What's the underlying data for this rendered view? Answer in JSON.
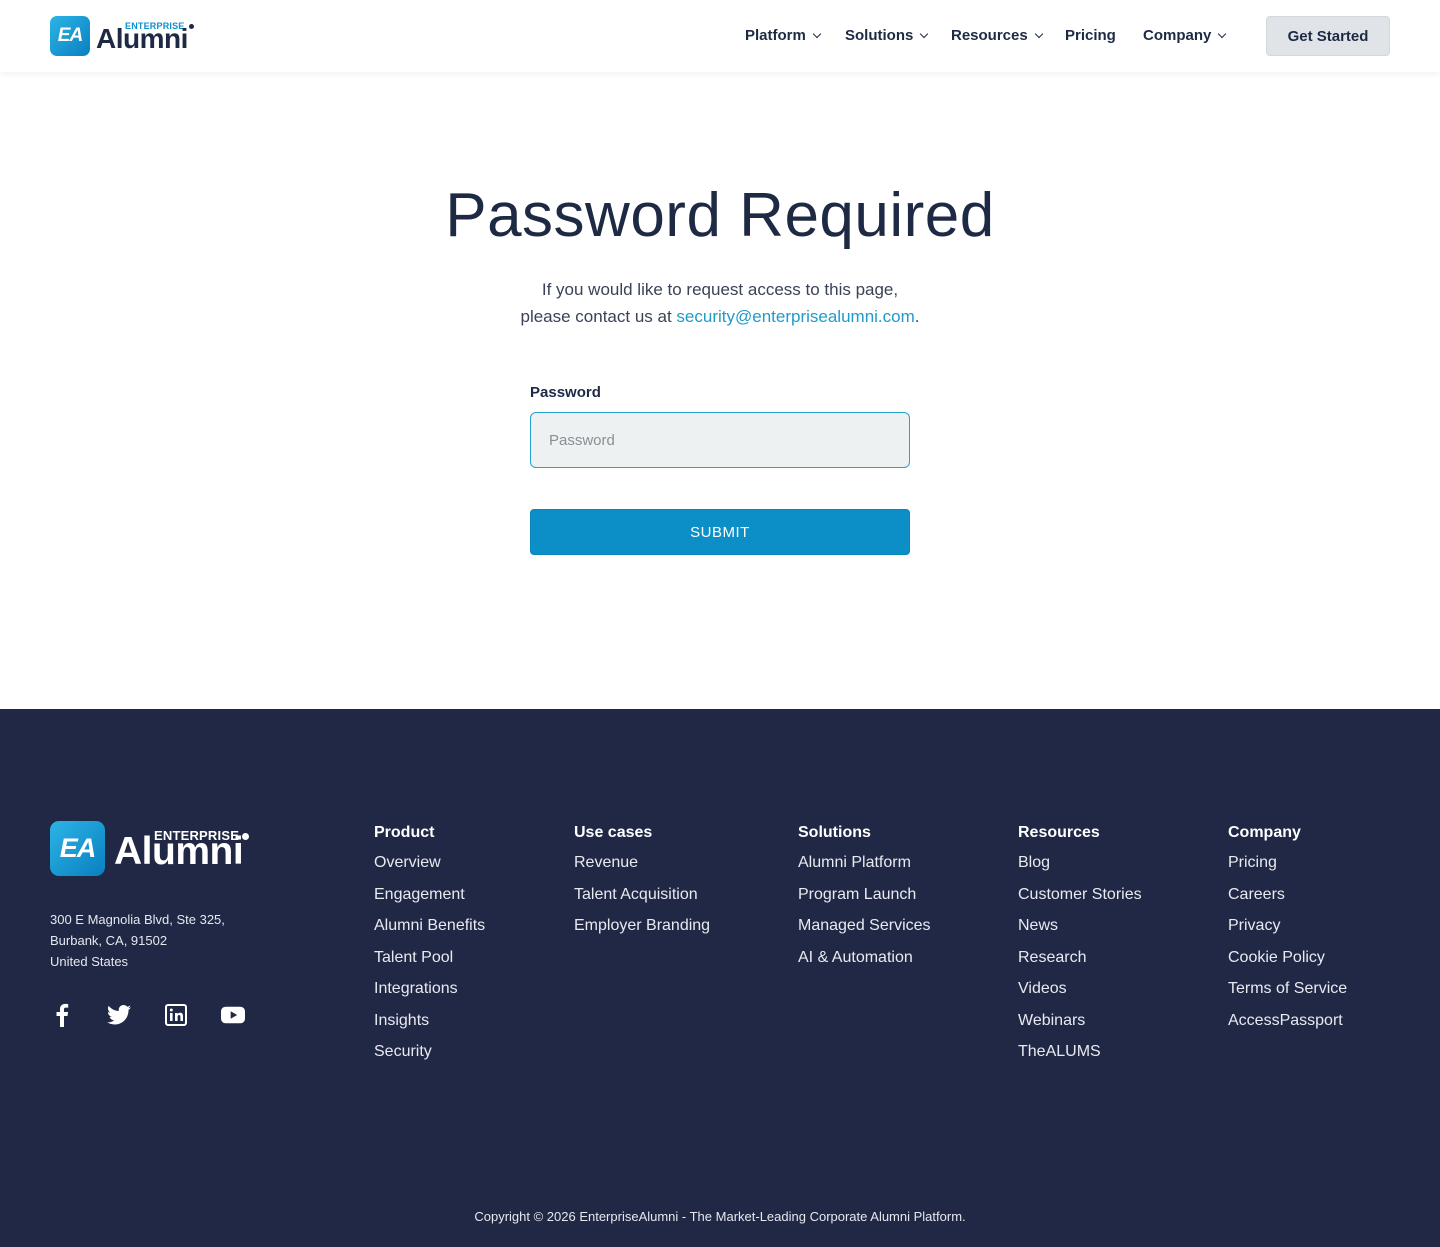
{
  "header": {
    "logo_small": "ENTERPRISE",
    "logo_big": "Alumni",
    "logo_mark": "EA",
    "nav": [
      {
        "label": "Platform",
        "dropdown": true
      },
      {
        "label": "Solutions",
        "dropdown": true
      },
      {
        "label": "Resources",
        "dropdown": true
      },
      {
        "label": "Pricing",
        "dropdown": false
      },
      {
        "label": "Company",
        "dropdown": true
      }
    ],
    "cta_label": "Get Started"
  },
  "main": {
    "title": "Password Required",
    "desc_line1": "If you would like to request access to this page,",
    "desc_line2_prefix": "please contact us at ",
    "email": "security@enterprisealumni.com",
    "desc_line2_suffix": ".",
    "password_label": "Password",
    "password_placeholder": "Password",
    "password_value": "",
    "submit_label": "SUBMIT"
  },
  "footer": {
    "logo_small": "ENTERPRISE",
    "logo_big": "Alumni",
    "logo_mark": "EA",
    "address": [
      "300 E Magnolia Blvd, Ste 325,",
      "Burbank, CA, 91502",
      "United States"
    ],
    "socials": [
      "facebook-icon",
      "twitter-icon",
      "linkedin-icon",
      "youtube-icon"
    ],
    "columns": [
      {
        "heading": "Product",
        "links": [
          "Overview",
          "Engagement",
          "Alumni Benefits",
          "Talent Pool",
          "Integrations",
          "Insights",
          "Security"
        ]
      },
      {
        "heading": "Use cases",
        "links": [
          "Revenue",
          "Talent Acquisition",
          "Employer Branding"
        ]
      },
      {
        "heading": "Solutions",
        "links": [
          "Alumni Platform",
          "Program Launch",
          "Managed Services",
          "AI & Automation"
        ]
      },
      {
        "heading": "Resources",
        "links": [
          "Blog",
          "Customer Stories",
          "News",
          "Research",
          "Videos",
          "Webinars",
          "TheALUMS"
        ]
      },
      {
        "heading": "Company",
        "links": [
          "Pricing",
          "Careers",
          "Privacy",
          "Cookie Policy",
          "Terms of Service",
          "AccessPassport"
        ]
      }
    ],
    "copyright": "Copyright © 2026 EnterpriseAlumni - The Market-Leading Corporate Alumni Platform."
  },
  "colors": {
    "navy": "#1e2a44",
    "footer_bg": "#212845",
    "accent": "#0c8fc6",
    "link": "#1f9bc7"
  }
}
